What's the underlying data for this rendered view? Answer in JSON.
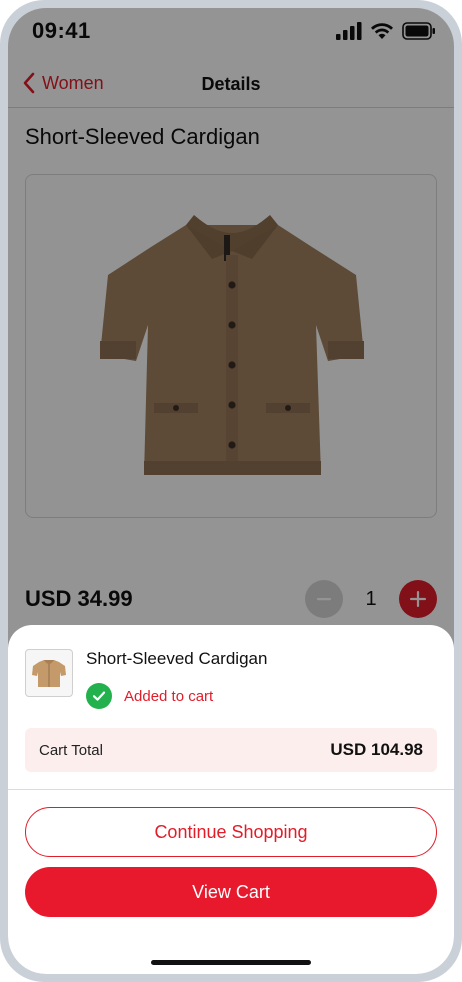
{
  "status_bar": {
    "time": "09:41",
    "icons": [
      "cellular-signal-icon",
      "wifi-icon",
      "battery-icon"
    ]
  },
  "nav": {
    "back_label": "Women",
    "title": "Details"
  },
  "product": {
    "title": "Short-Sleeved Cardigan",
    "image": "cardigan-image",
    "price": "USD 34.99",
    "quantity": "1"
  },
  "sheet": {
    "product_name": "Short-Sleeved Cardigan",
    "status_text": "Added to cart",
    "cart_total_label": "Cart Total",
    "cart_total_value": "USD 104.98",
    "continue_label": "Continue Shopping",
    "view_cart_label": "View Cart"
  },
  "colors": {
    "accent": "#e11d2a",
    "success": "#22b14c",
    "total_bg": "#fdeeee",
    "overlay": "rgba(0,0,0,0.42)"
  }
}
